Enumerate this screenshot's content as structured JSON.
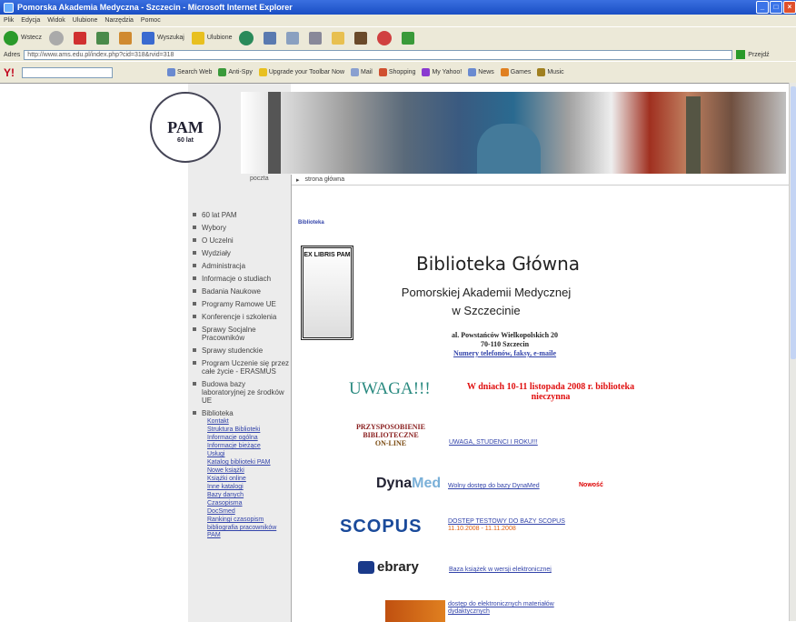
{
  "window": {
    "title": "Pomorska Akademia Medyczna - Szczecin - Microsoft Internet Explorer"
  },
  "menubar": [
    "Plik",
    "Edycja",
    "Widok",
    "Ulubione",
    "Narzędzia",
    "Pomoc"
  ],
  "toolbar": {
    "back": "Wstecz",
    "search": "Wyszukaj",
    "favorites": "Ulubione"
  },
  "address": {
    "label": "Adres",
    "url": "http://www.ams.edu.pl/index.php?cid=318&rvid=318",
    "go": "Przejdź"
  },
  "yahoo": {
    "logo": "Y!",
    "items": [
      "Search Web",
      "Anti-Spy",
      "Upgrade your Toolbar Now",
      "Mail",
      "Shopping",
      "My Yahoo!",
      "News",
      "Games",
      "Music"
    ]
  },
  "site": {
    "logo_text": "PAM",
    "logo_years": "60 lat",
    "poczta": "poczta",
    "breadcrumb": [
      "▸",
      "strona główna"
    ],
    "menu": [
      "60 lat PAM",
      "Wybory",
      "O Uczelni",
      "Wydziały",
      "Administracja",
      "Informacje o studiach",
      "Badania Naukowe",
      "Programy Ramowe UE",
      "Konferencje i szkolenia",
      "Sprawy Socjalne Pracowników",
      "Sprawy studenckie",
      "Program Uczenie się przez całe życie - ERASMUS",
      "Budowa bazy laboratoryjnej ze środków UE",
      "Biblioteka"
    ],
    "submenu": [
      "Kontakt",
      "Struktura Biblioteki",
      "Informacje ogólna",
      "Informacje bieżące",
      "Usługi",
      "Katalog biblioteki PAM",
      "Nowe książki",
      "Książki online",
      "Inne katalogi",
      "Bazy danych",
      "Czasopisma",
      "DocSmed",
      "Rankingi czasopism",
      "bibliografia pracowników PAM"
    ]
  },
  "content": {
    "section": "Biblioteka",
    "exlibris": "EX LIBRIS PAM",
    "title": "Biblioteka Główna",
    "subtitle1": "Pomorskiej Akademii Medycznej",
    "subtitle2": "w Szczecinie",
    "addr1": "al. Powstańców Wielkopolskich 20",
    "addr2": "70-110 Szczecin",
    "contacts": "Numery telefonów, faksy, e-maile",
    "uwaga": "UWAGA!!!",
    "notice": "W dniach 10-11 listopada 2008 r. biblioteka nieczynna",
    "przys1": "PRZYSPOSOBIENIE",
    "przys2": "BIBLIOTECZNE",
    "przys3": "ON-LINE",
    "studenci": "UWAGA, STUDENCI I ROKU!!!",
    "dyna1": "Dyna",
    "dyna2": "Med",
    "dynalink": "Wolny dostęp do bazy DynaMed",
    "nowosc": "Nowość",
    "scopus": "SCOPUS",
    "scoplink": "DOSTĘP TESTOWY DO BAZY SCOPUS",
    "scopdate": "11.10.2008 - 11.11.2008",
    "ebrary": "ebrary",
    "eblink": "Baza książek w wersji elektronicznej",
    "dydlink": "dostęp do elektronicznych materiałów dydaktycznych"
  }
}
